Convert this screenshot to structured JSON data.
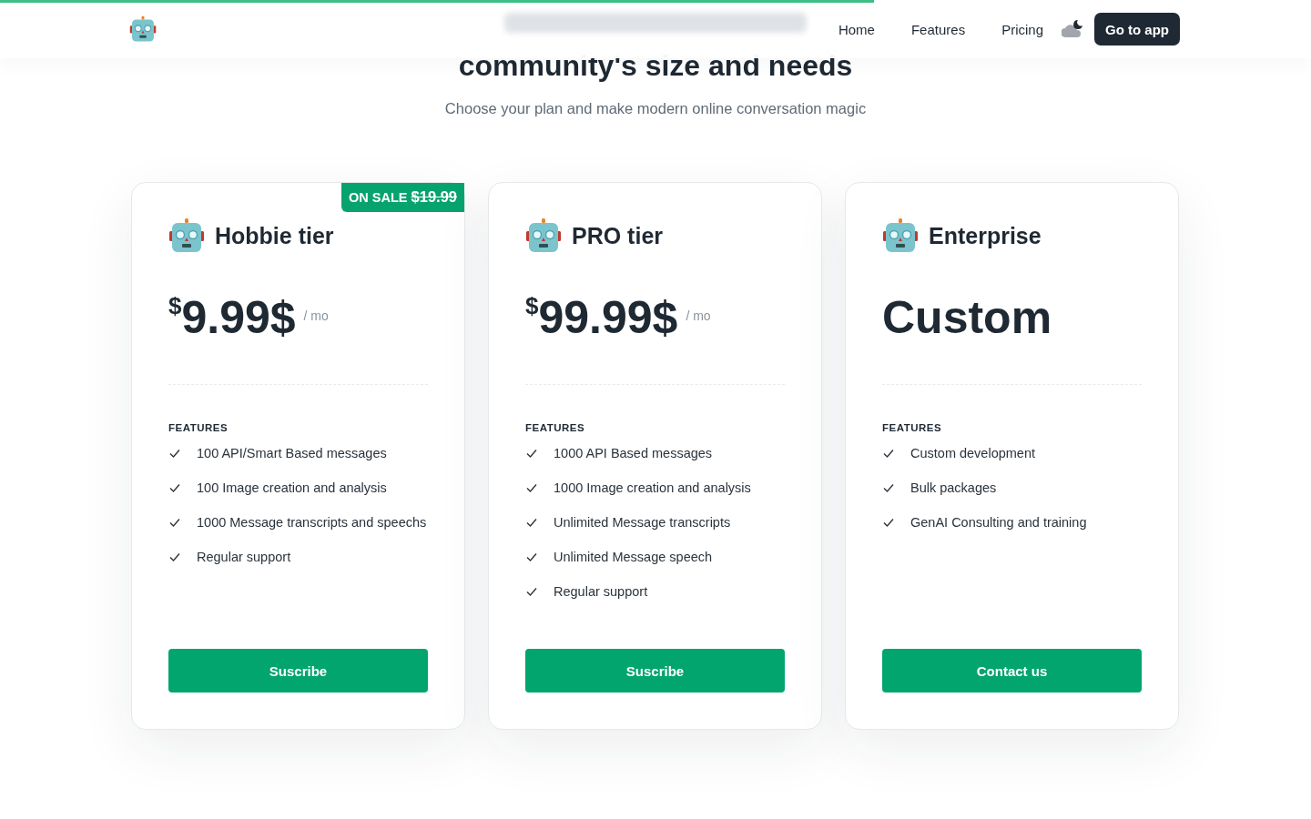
{
  "scroll_progress": {
    "level": 0.667
  },
  "nav": {
    "links": [
      "Home",
      "Features",
      "Pricing"
    ],
    "cta": "Go to app"
  },
  "hero": {
    "title": "community's size and needs",
    "subtitle": "Choose your plan and make modern online conversation magic"
  },
  "plans": [
    {
      "name": "Hobbie tier",
      "sale": {
        "label": "ON SALE",
        "old_price": "$19.99"
      },
      "currency": "$",
      "price": "9.99$",
      "period": "/ mo",
      "features_heading": "FEATURES",
      "features": [
        "100 API/Smart Based messages",
        "100 Image creation and analysis",
        "1000 Message transcripts and speechs",
        "Regular support"
      ],
      "button": "Suscribe"
    },
    {
      "name": "PRO tier",
      "currency": "$",
      "price": "99.99$",
      "period": "/ mo",
      "features_heading": "FEATURES",
      "features": [
        "1000 API Based messages",
        "1000 Image creation and analysis",
        "Unlimited Message transcripts",
        "Unlimited Message speech",
        "Regular support"
      ],
      "button": "Suscribe"
    },
    {
      "name": "Enterprise",
      "price": "Custom",
      "features_heading": "FEATURES",
      "features": [
        "Custom development",
        "Bulk packages",
        "GenAI Consulting and training"
      ],
      "button": "Contact us"
    }
  ]
}
